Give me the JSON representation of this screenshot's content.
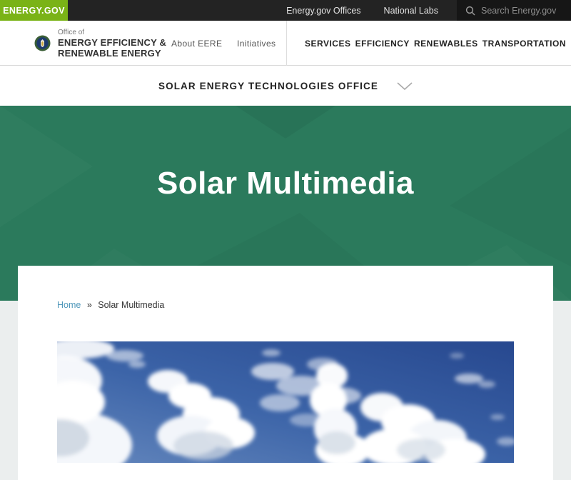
{
  "top_bar": {
    "logo_text": "ENERGY.GOV",
    "links": [
      "Energy.gov Offices",
      "National Labs"
    ],
    "search_placeholder": "Search Energy.gov"
  },
  "header": {
    "office_of": "Office of",
    "org_line1": "ENERGY EFFICIENCY &",
    "org_line2": "RENEWABLE ENERGY",
    "about_link": "About EERE",
    "initiatives_link": "Initiatives",
    "nav": [
      "SERVICES",
      "EFFICIENCY",
      "RENEWABLES",
      "TRANSPORTATION"
    ]
  },
  "office_bar": {
    "title": "SOLAR ENERGY TECHNOLOGIES OFFICE"
  },
  "hero": {
    "title": "Solar Multimedia"
  },
  "breadcrumb": {
    "home": "Home",
    "separator": "»",
    "current": "Solar Multimedia"
  },
  "media": {
    "description": "Blue sky with white cumulus clouds"
  },
  "colors": {
    "hero_green": "#2b7a5c",
    "logo_green": "#7ab317",
    "topbar_dark": "#232323",
    "link_blue": "#4e97ba"
  }
}
